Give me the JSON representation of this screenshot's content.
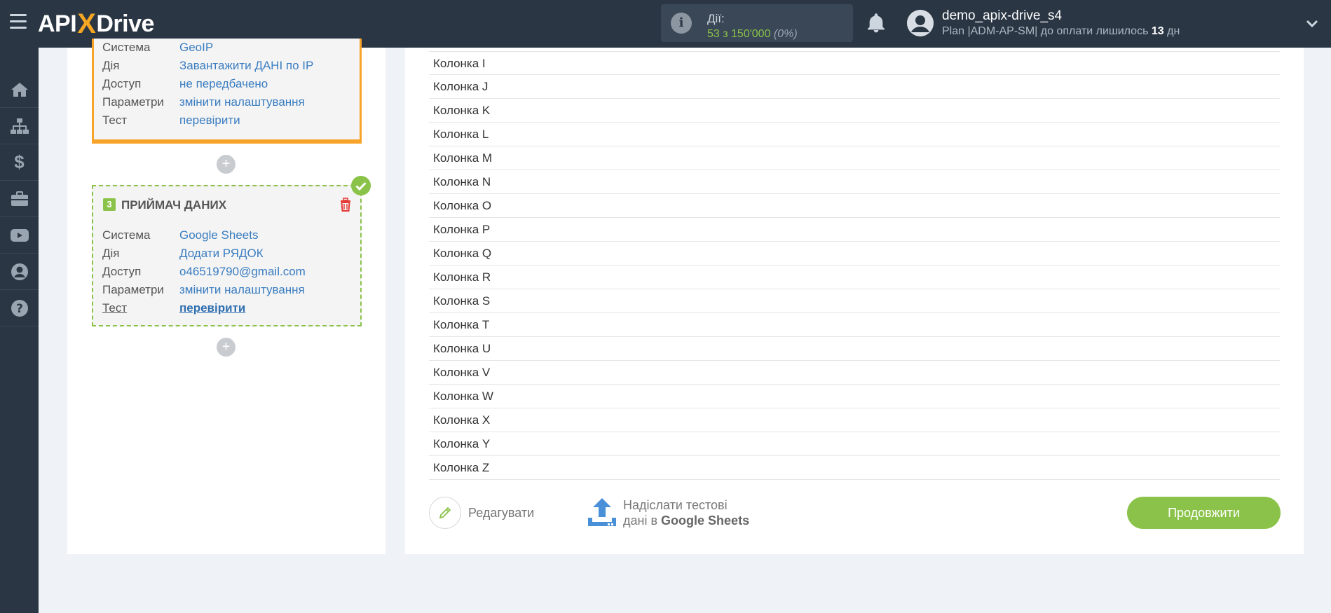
{
  "header": {
    "logo_left": "API",
    "logo_x": "X",
    "logo_right": "Drive",
    "actions_label": "Дії:",
    "actions_value": "53 з 150'000",
    "actions_percent": "(0%)",
    "user_name": "demo_apix-drive_s4",
    "plan_prefix": "Plan |ADM-AP-SM| до оплати лишилось",
    "plan_days": "13",
    "plan_suffix": "дн"
  },
  "sidebar": {
    "items": [
      "home-icon",
      "sitemap-icon",
      "dollar-icon",
      "briefcase-icon",
      "youtube-icon",
      "user-icon",
      "help-icon"
    ]
  },
  "source_block": {
    "rows": [
      {
        "key": "Система",
        "value": "GeoIP"
      },
      {
        "key": "Дія",
        "value": "Завантажити ДАНІ по IP"
      },
      {
        "key": "Доступ",
        "value": "не передбачено"
      },
      {
        "key": "Параметри",
        "value": "змінити налаштування"
      },
      {
        "key": "Тест",
        "value": "перевірити"
      }
    ]
  },
  "receiver_block": {
    "number": "3",
    "title": "ПРИЙМАЧ ДАНИХ",
    "rows": [
      {
        "key": "Система",
        "value": "Google Sheets"
      },
      {
        "key": "Дія",
        "value": "Додати РЯДОК"
      },
      {
        "key": "Доступ",
        "value": "o46519790@gmail.com"
      },
      {
        "key": "Параметри",
        "value": "змінити налаштування"
      },
      {
        "key": "Тест",
        "value": "перевірити"
      }
    ]
  },
  "columns": [
    "Колонка I",
    "Колонка J",
    "Колонка K",
    "Колонка L",
    "Колонка M",
    "Колонка N",
    "Колонка O",
    "Колонка P",
    "Колонка Q",
    "Колонка R",
    "Колонка S",
    "Колонка T",
    "Колонка U",
    "Колонка V",
    "Колонка W",
    "Колонка X",
    "Колонка Y",
    "Колонка Z"
  ],
  "footer": {
    "edit_label": "Редагувати",
    "send_line1": "Надіслати тестові",
    "send_line2_prefix": "дані в",
    "send_line2_bold": "Google Sheets",
    "continue_label": "Продовжити"
  },
  "colors": {
    "accent_green": "#8bc34a",
    "accent_orange": "#f7a32a",
    "link_blue": "#3a7dc1",
    "dark_bg": "#2a3644"
  }
}
